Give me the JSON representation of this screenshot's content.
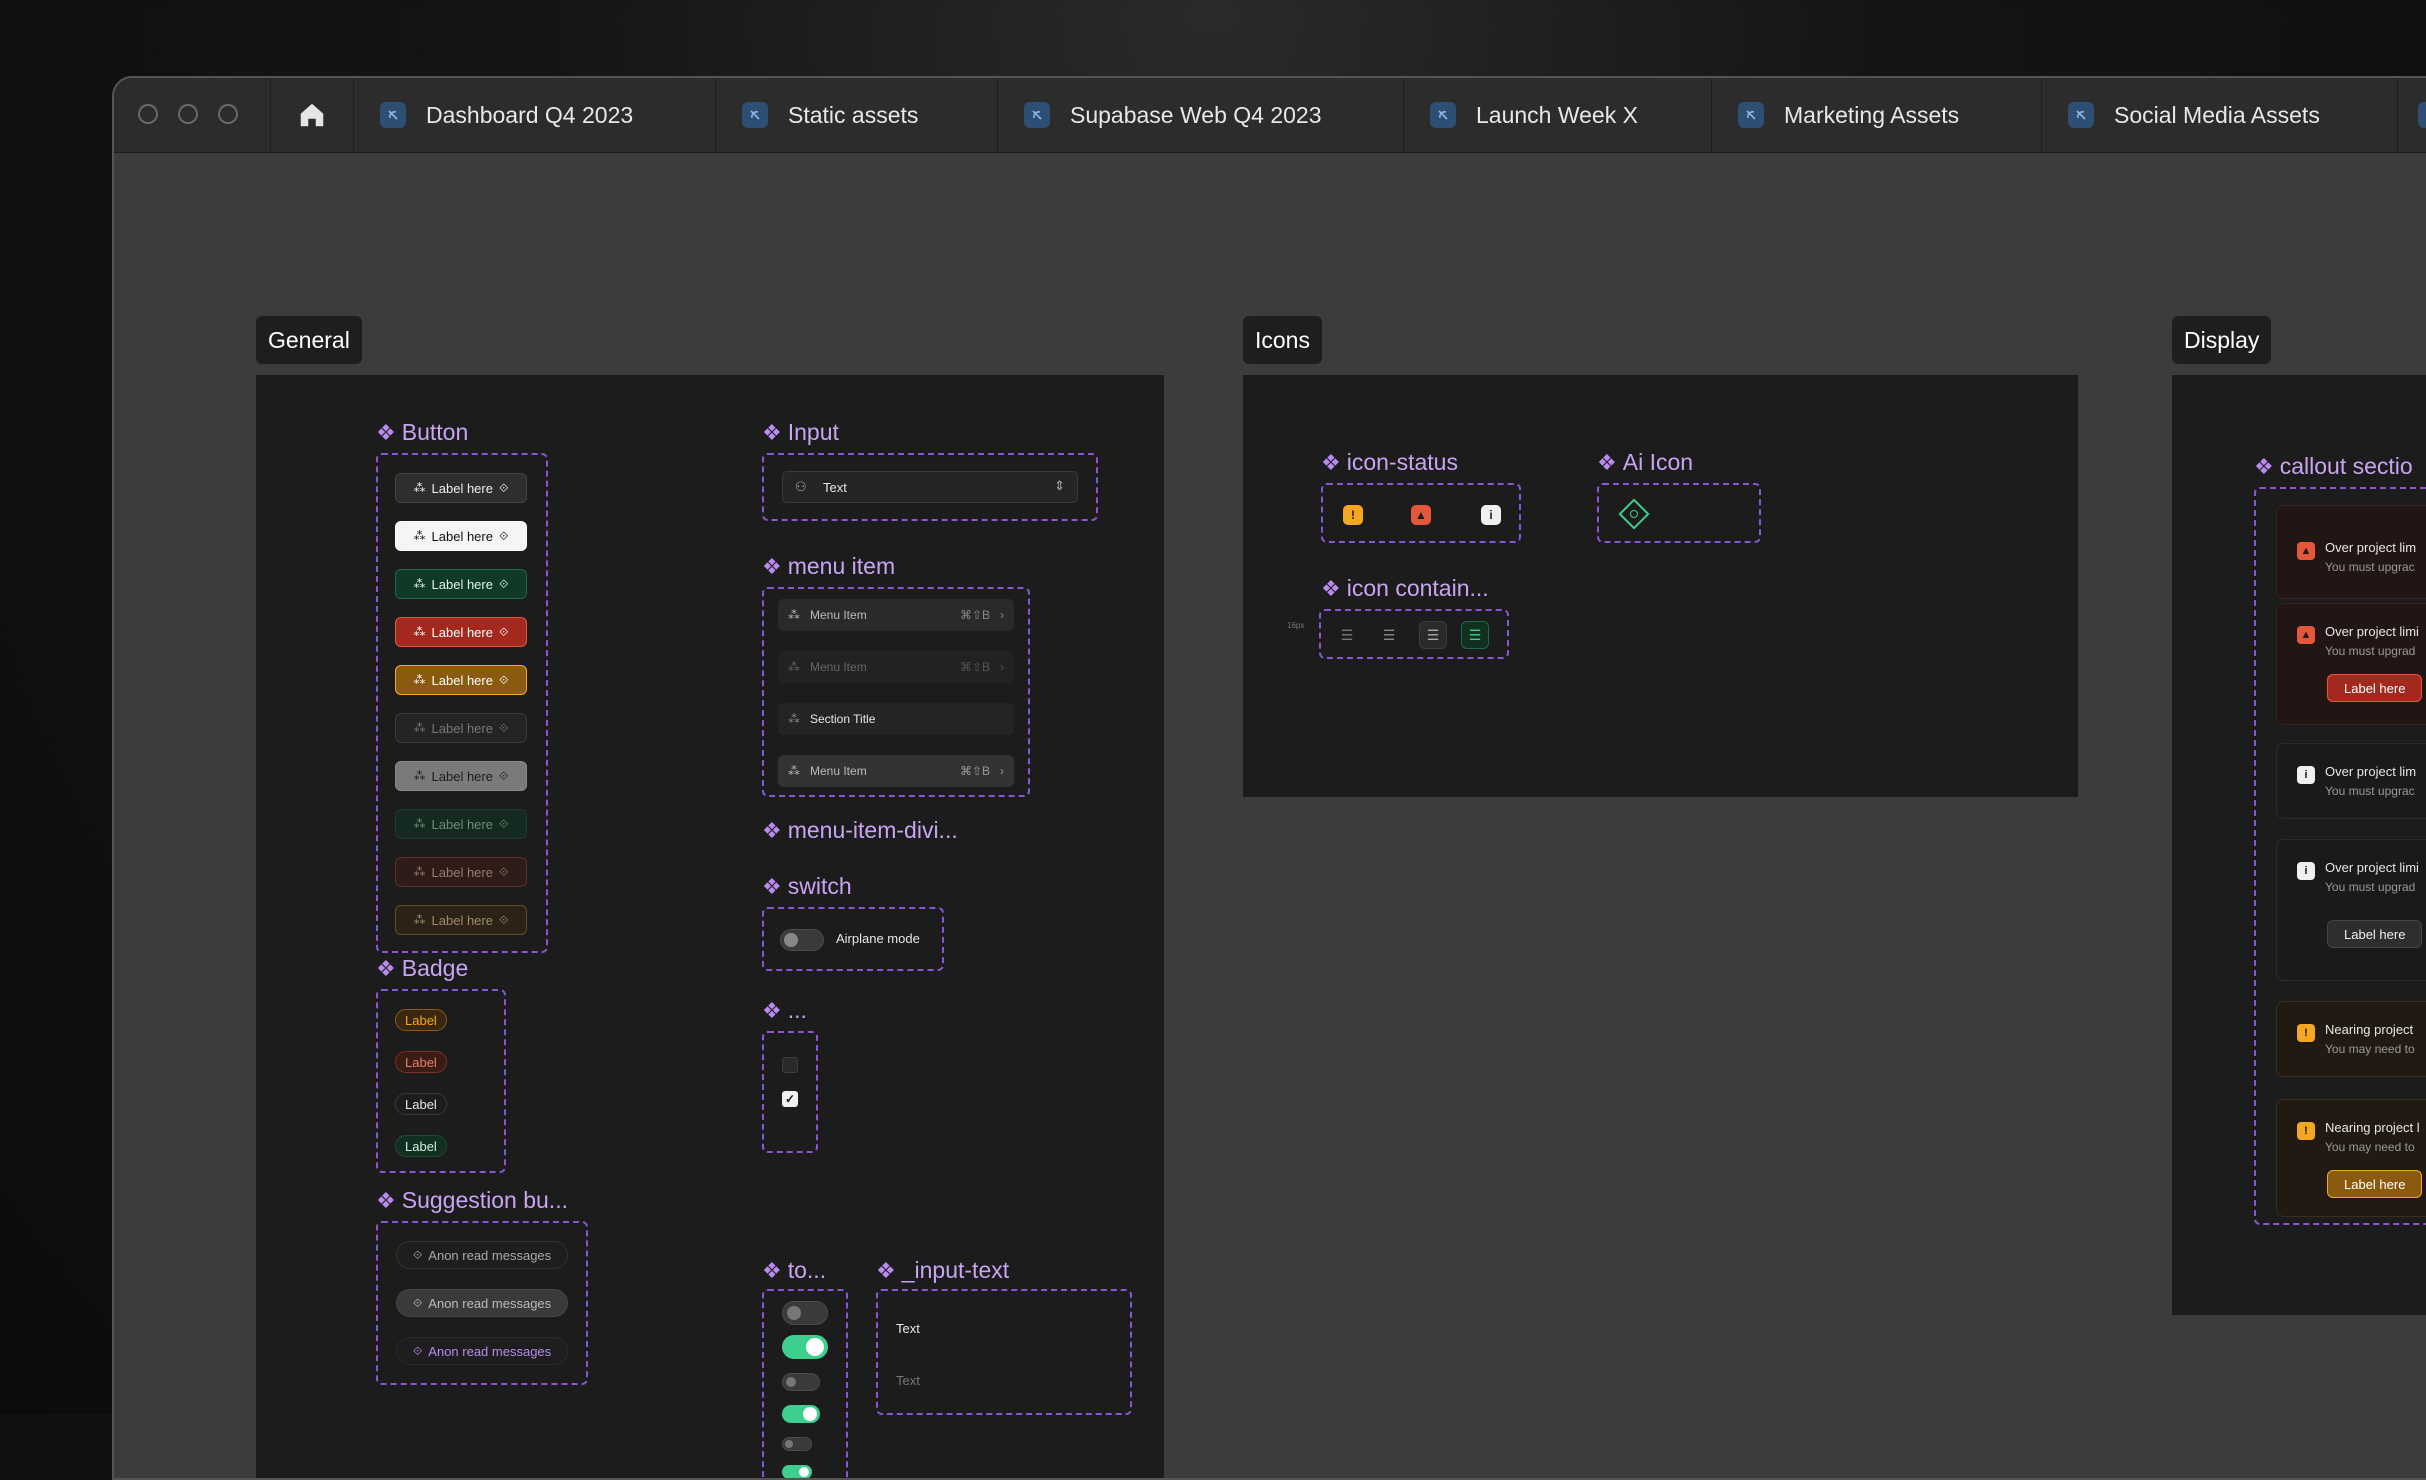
{
  "tabs": [
    {
      "label": "Dashboard Q4 2023"
    },
    {
      "label": "Static assets"
    },
    {
      "label": "Supabase Web Q4 2023"
    },
    {
      "label": "Launch Week X"
    },
    {
      "label": "Marketing Assets"
    },
    {
      "label": "Social Media Assets"
    }
  ],
  "sections": {
    "general": "General",
    "icons": "Icons",
    "display": "Display"
  },
  "components": {
    "button": "Button",
    "badge": "Badge",
    "suggestion": "Suggestion bu...",
    "input": "Input",
    "menu_item": "menu item",
    "menu_item_divider": "menu-item-divi...",
    "switch": "switch",
    "checkbox": "...",
    "toggle": "to...",
    "input_text": "_input-text",
    "icon_status": "icon-status",
    "ai_icon": "Ai Icon",
    "icon_container": "icon contain...",
    "callout": "callout sectio"
  },
  "button_label": "Label here",
  "badge_label": "Label",
  "suggestion_label": "Anon read messages",
  "input": {
    "value": "Text"
  },
  "menu": {
    "item_label": "Menu Item",
    "shortcut": "⌘⇧B",
    "section_title": "Section Title"
  },
  "switch_label": "Airplane mode",
  "input_text": {
    "value": "Text",
    "placeholder": "Text"
  },
  "icon_container_note": "16px",
  "callouts": {
    "over_title": "Over project lim",
    "over_title_b": "Over project limi",
    "over_sub": "You must upgrac",
    "over_sub_b": "You must upgrad",
    "nearing_title": "Nearing project",
    "nearing_title_b": "Nearing project l",
    "nearing_sub": "You may need to",
    "btn_label": "Label here"
  },
  "colors": {
    "accent_purple": "#8a56d6",
    "danger": "#e5573b",
    "warning": "#f5a623",
    "brand_green": "#3ecf8e"
  }
}
